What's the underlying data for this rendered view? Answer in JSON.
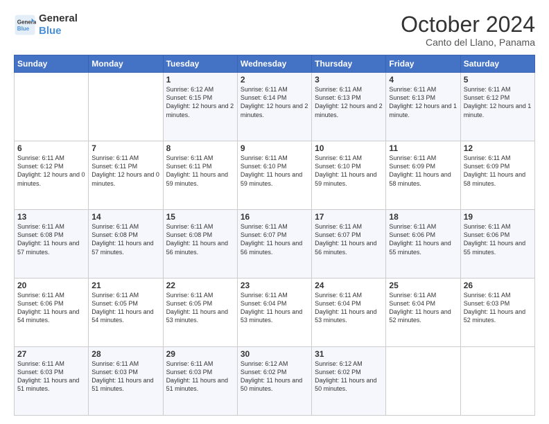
{
  "logo": {
    "line1": "General",
    "line2": "Blue"
  },
  "title": "October 2024",
  "location": "Canto del Llano, Panama",
  "days_of_week": [
    "Sunday",
    "Monday",
    "Tuesday",
    "Wednesday",
    "Thursday",
    "Friday",
    "Saturday"
  ],
  "weeks": [
    [
      {
        "day": "",
        "content": ""
      },
      {
        "day": "",
        "content": ""
      },
      {
        "day": "1",
        "content": "Sunrise: 6:12 AM\nSunset: 6:15 PM\nDaylight: 12 hours and 2 minutes."
      },
      {
        "day": "2",
        "content": "Sunrise: 6:11 AM\nSunset: 6:14 PM\nDaylight: 12 hours and 2 minutes."
      },
      {
        "day": "3",
        "content": "Sunrise: 6:11 AM\nSunset: 6:13 PM\nDaylight: 12 hours and 2 minutes."
      },
      {
        "day": "4",
        "content": "Sunrise: 6:11 AM\nSunset: 6:13 PM\nDaylight: 12 hours and 1 minute."
      },
      {
        "day": "5",
        "content": "Sunrise: 6:11 AM\nSunset: 6:12 PM\nDaylight: 12 hours and 1 minute."
      }
    ],
    [
      {
        "day": "6",
        "content": "Sunrise: 6:11 AM\nSunset: 6:12 PM\nDaylight: 12 hours and 0 minutes."
      },
      {
        "day": "7",
        "content": "Sunrise: 6:11 AM\nSunset: 6:11 PM\nDaylight: 12 hours and 0 minutes."
      },
      {
        "day": "8",
        "content": "Sunrise: 6:11 AM\nSunset: 6:11 PM\nDaylight: 11 hours and 59 minutes."
      },
      {
        "day": "9",
        "content": "Sunrise: 6:11 AM\nSunset: 6:10 PM\nDaylight: 11 hours and 59 minutes."
      },
      {
        "day": "10",
        "content": "Sunrise: 6:11 AM\nSunset: 6:10 PM\nDaylight: 11 hours and 59 minutes."
      },
      {
        "day": "11",
        "content": "Sunrise: 6:11 AM\nSunset: 6:09 PM\nDaylight: 11 hours and 58 minutes."
      },
      {
        "day": "12",
        "content": "Sunrise: 6:11 AM\nSunset: 6:09 PM\nDaylight: 11 hours and 58 minutes."
      }
    ],
    [
      {
        "day": "13",
        "content": "Sunrise: 6:11 AM\nSunset: 6:08 PM\nDaylight: 11 hours and 57 minutes."
      },
      {
        "day": "14",
        "content": "Sunrise: 6:11 AM\nSunset: 6:08 PM\nDaylight: 11 hours and 57 minutes."
      },
      {
        "day": "15",
        "content": "Sunrise: 6:11 AM\nSunset: 6:08 PM\nDaylight: 11 hours and 56 minutes."
      },
      {
        "day": "16",
        "content": "Sunrise: 6:11 AM\nSunset: 6:07 PM\nDaylight: 11 hours and 56 minutes."
      },
      {
        "day": "17",
        "content": "Sunrise: 6:11 AM\nSunset: 6:07 PM\nDaylight: 11 hours and 56 minutes."
      },
      {
        "day": "18",
        "content": "Sunrise: 6:11 AM\nSunset: 6:06 PM\nDaylight: 11 hours and 55 minutes."
      },
      {
        "day": "19",
        "content": "Sunrise: 6:11 AM\nSunset: 6:06 PM\nDaylight: 11 hours and 55 minutes."
      }
    ],
    [
      {
        "day": "20",
        "content": "Sunrise: 6:11 AM\nSunset: 6:06 PM\nDaylight: 11 hours and 54 minutes."
      },
      {
        "day": "21",
        "content": "Sunrise: 6:11 AM\nSunset: 6:05 PM\nDaylight: 11 hours and 54 minutes."
      },
      {
        "day": "22",
        "content": "Sunrise: 6:11 AM\nSunset: 6:05 PM\nDaylight: 11 hours and 53 minutes."
      },
      {
        "day": "23",
        "content": "Sunrise: 6:11 AM\nSunset: 6:04 PM\nDaylight: 11 hours and 53 minutes."
      },
      {
        "day": "24",
        "content": "Sunrise: 6:11 AM\nSunset: 6:04 PM\nDaylight: 11 hours and 53 minutes."
      },
      {
        "day": "25",
        "content": "Sunrise: 6:11 AM\nSunset: 6:04 PM\nDaylight: 11 hours and 52 minutes."
      },
      {
        "day": "26",
        "content": "Sunrise: 6:11 AM\nSunset: 6:03 PM\nDaylight: 11 hours and 52 minutes."
      }
    ],
    [
      {
        "day": "27",
        "content": "Sunrise: 6:11 AM\nSunset: 6:03 PM\nDaylight: 11 hours and 51 minutes."
      },
      {
        "day": "28",
        "content": "Sunrise: 6:11 AM\nSunset: 6:03 PM\nDaylight: 11 hours and 51 minutes."
      },
      {
        "day": "29",
        "content": "Sunrise: 6:11 AM\nSunset: 6:03 PM\nDaylight: 11 hours and 51 minutes."
      },
      {
        "day": "30",
        "content": "Sunrise: 6:12 AM\nSunset: 6:02 PM\nDaylight: 11 hours and 50 minutes."
      },
      {
        "day": "31",
        "content": "Sunrise: 6:12 AM\nSunset: 6:02 PM\nDaylight: 11 hours and 50 minutes."
      },
      {
        "day": "",
        "content": ""
      },
      {
        "day": "",
        "content": ""
      }
    ]
  ]
}
